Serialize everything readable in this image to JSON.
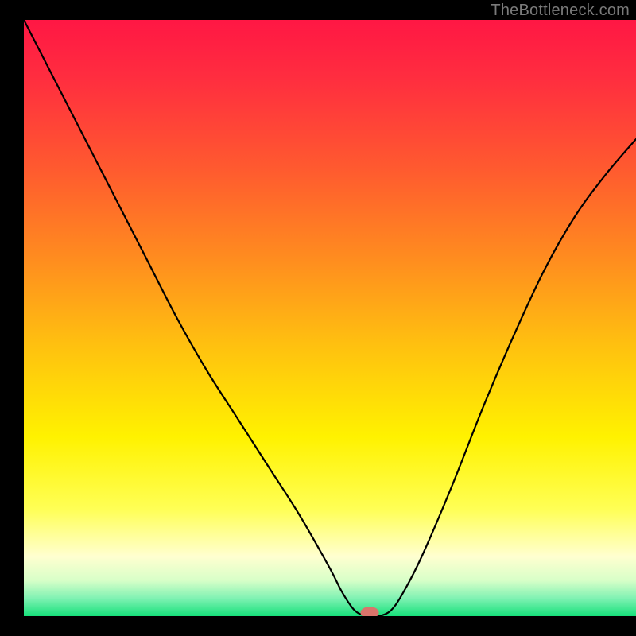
{
  "watermark": "TheBottleneck.com",
  "chart_data": {
    "type": "line",
    "title": "",
    "xlabel": "",
    "ylabel": "",
    "xlim": [
      0,
      100
    ],
    "ylim": [
      0,
      100
    ],
    "grid": false,
    "legend": false,
    "background_gradient": {
      "stops": [
        {
          "offset": 0.0,
          "color": "#ff1744"
        },
        {
          "offset": 0.1,
          "color": "#ff2e3f"
        },
        {
          "offset": 0.25,
          "color": "#ff5a2f"
        },
        {
          "offset": 0.4,
          "color": "#ff8c1f"
        },
        {
          "offset": 0.55,
          "color": "#ffc20f"
        },
        {
          "offset": 0.7,
          "color": "#fff200"
        },
        {
          "offset": 0.82,
          "color": "#ffff55"
        },
        {
          "offset": 0.9,
          "color": "#ffffd0"
        },
        {
          "offset": 0.94,
          "color": "#d8ffc8"
        },
        {
          "offset": 0.97,
          "color": "#80f2b3"
        },
        {
          "offset": 1.0,
          "color": "#16e07a"
        }
      ]
    },
    "series": [
      {
        "name": "bottleneck-curve",
        "color": "#000000",
        "width": 2.2,
        "x": [
          0,
          2,
          5,
          8,
          12,
          16,
          20,
          25,
          30,
          35,
          40,
          45,
          50,
          52,
          54,
          56,
          58,
          60,
          62,
          65,
          70,
          75,
          80,
          85,
          90,
          95,
          100
        ],
        "y": [
          100,
          96,
          90,
          84,
          76,
          68,
          60,
          50,
          41,
          33,
          25,
          17,
          8,
          4,
          1,
          0,
          0,
          1,
          4,
          10,
          22,
          35,
          47,
          58,
          67,
          74,
          80
        ]
      }
    ],
    "marker": {
      "name": "optimal-point",
      "x": 56.5,
      "y": 0.6,
      "rx": 1.5,
      "ry": 1.0,
      "color": "#d9746b"
    }
  }
}
